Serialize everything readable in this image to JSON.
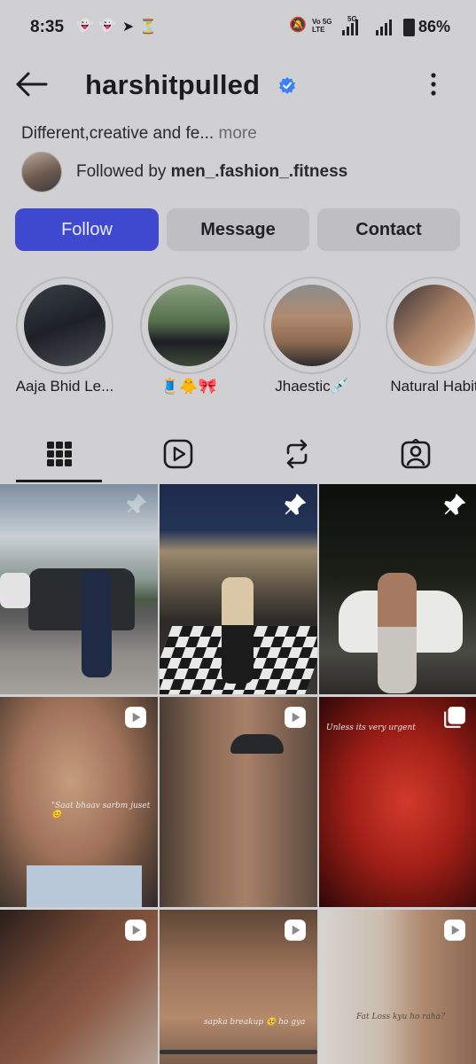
{
  "status_bar": {
    "time": "8:35",
    "network_line1": "Vo 5G",
    "network_line2": "LTE",
    "network_5g": "5G",
    "battery": "86%"
  },
  "header": {
    "username": "harshitpulled",
    "back_icon": "arrow-left-icon",
    "verified_icon": "verified-badge-icon",
    "menu_icon": "more-vertical-icon"
  },
  "profile": {
    "bio": "Different,creative and fe...",
    "bio_more": "more",
    "followed_prefix": "Followed by",
    "followed_user": "men_.fashion_.fitness"
  },
  "actions": {
    "follow": "Follow",
    "message": "Message",
    "contact": "Contact"
  },
  "highlights": [
    {
      "label": "Aaja Bhid Le..."
    },
    {
      "label": "🧵🐥🎀"
    },
    {
      "label": "Jhaestic💉"
    },
    {
      "label": "Natural Habit"
    }
  ],
  "tabs": [
    {
      "icon": "grid-icon",
      "active": true
    },
    {
      "icon": "reels-icon",
      "active": false
    },
    {
      "icon": "repost-icon",
      "active": false
    },
    {
      "icon": "tagged-icon",
      "active": false
    }
  ],
  "posts": [
    {
      "type": "pinned",
      "caption": ""
    },
    {
      "type": "pinned",
      "caption": ""
    },
    {
      "type": "pinned",
      "caption": ""
    },
    {
      "type": "reel",
      "caption": "\"Saat bhaav sarbm juset 😊"
    },
    {
      "type": "reel",
      "caption": ""
    },
    {
      "type": "carousel",
      "caption": "Unless its very urgent"
    },
    {
      "type": "reel",
      "caption": ""
    },
    {
      "type": "reel",
      "caption": "sapka breakup 🥺 ho gya"
    },
    {
      "type": "reel",
      "caption": "Fat Loss kyu ho raha?"
    }
  ],
  "colors": {
    "follow_button": "#3f49d0",
    "secondary_button": "#bfbfc3",
    "verified": "#3b82f6"
  }
}
